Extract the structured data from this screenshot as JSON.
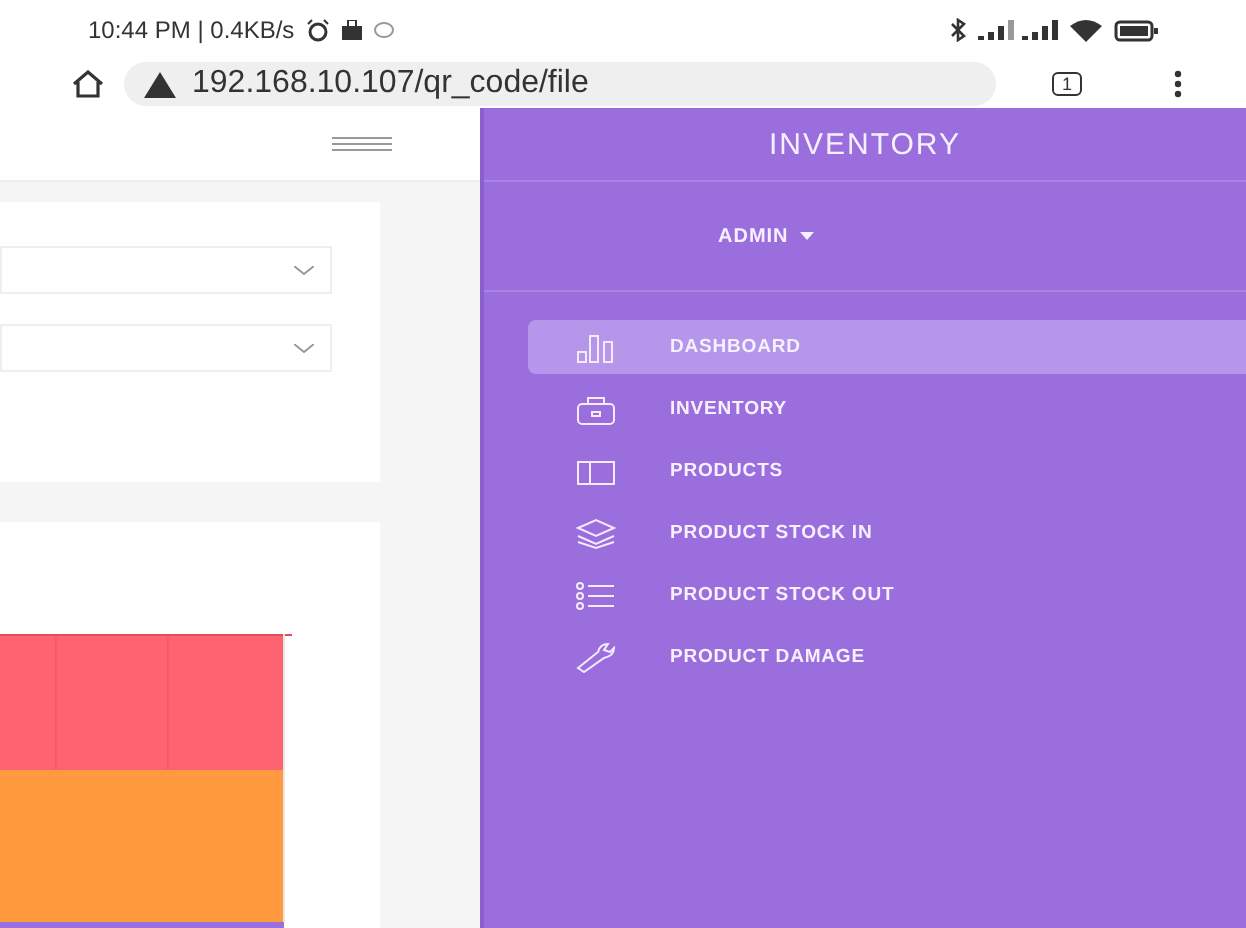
{
  "status_bar": {
    "time": "10:44 PM | 0.4KB/s"
  },
  "browser": {
    "url": "192.168.10.107/qr_code/file",
    "tab_count": "1"
  },
  "main": {
    "selects": [
      {
        "kind": "select"
      },
      {
        "kind": "select"
      }
    ]
  },
  "sidebar": {
    "title": "INVENTORY",
    "user": "ADMIN",
    "items": [
      {
        "label": "DASHBOARD",
        "selected": true
      },
      {
        "label": "INVENTORY",
        "selected": false
      },
      {
        "label": "PRODUCTS",
        "selected": false
      },
      {
        "label": "PRODUCT STOCK IN",
        "selected": false
      },
      {
        "label": "PRODUCT STOCK OUT",
        "selected": false
      },
      {
        "label": "PRODUCT DAMAGE",
        "selected": false
      }
    ]
  }
}
